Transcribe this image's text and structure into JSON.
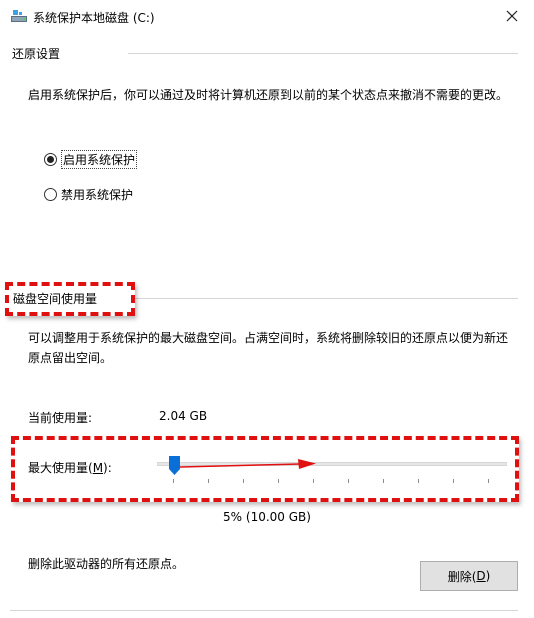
{
  "window": {
    "title": "系统保护本地磁盘 (C:)",
    "close_glyph": "✕"
  },
  "restore_settings": {
    "group_title": "还原设置",
    "description": "启用系统保护后，你可以通过及时将计算机还原到以前的某个状态点来撤消不需要的更改。",
    "options": [
      {
        "label": "启用系统保护",
        "checked": true
      },
      {
        "label": "禁用系统保护",
        "checked": false
      }
    ]
  },
  "disk_usage": {
    "group_title": "磁盘空间使用量",
    "description": "可以调整用于系统保护的最大磁盘空间。占满空间时，系统将删除较旧的还原点以便为新还原点留出空间。",
    "current_label": "当前使用量:",
    "current_value": "2.04 GB",
    "max_label_prefix": "最大使用量(",
    "max_label_hotkey": "M",
    "max_label_suffix": "):",
    "slider_percent": 5,
    "percent_text": "5% (10.00 GB)"
  },
  "delete_section": {
    "label": "删除此驱动器的所有还原点。",
    "button_prefix": "删除(",
    "button_hotkey": "D",
    "button_suffix": ")"
  },
  "colors": {
    "annotation_red": "#e01010",
    "thumb_blue": "#0a6fd6"
  }
}
